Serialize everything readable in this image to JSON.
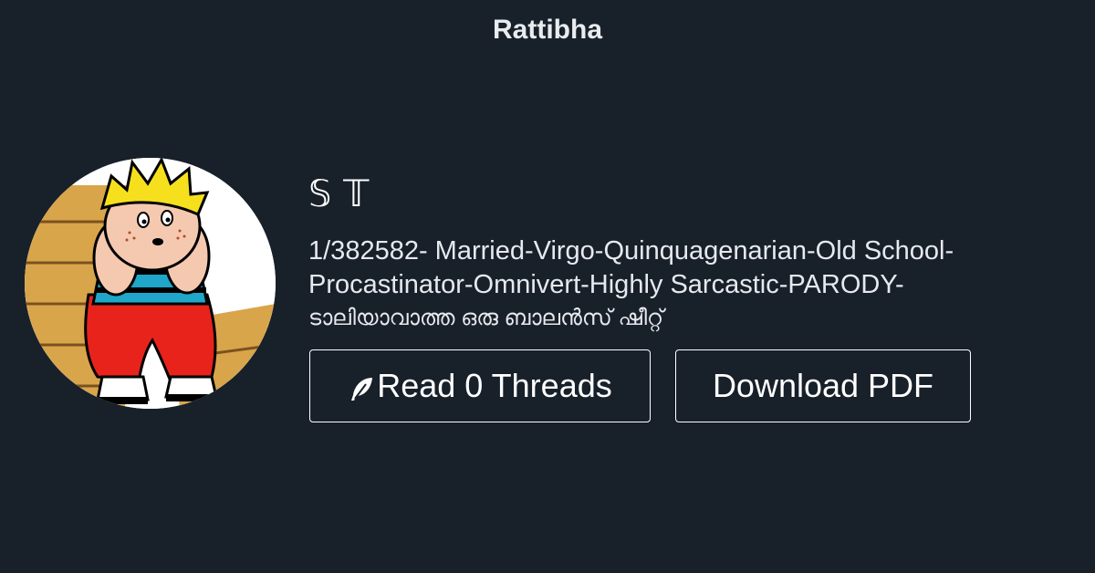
{
  "header": {
    "brand": "Rattibha"
  },
  "profile": {
    "avatar_icon": "cartoon-boy-avatar",
    "display_name": "𝕊 𝕋",
    "bio_line": "1/382582- Married-Virgo-Quinquagenarian-Old School-Procastinator-Omnivert-Highly Sarcastic-PARODY-",
    "bio_malayalam": "ടാലിയാവാത്ത ഒരു ബാലൻസ് ഷീറ്റ്"
  },
  "actions": {
    "read_label": "Read 0 Threads",
    "read_icon": "feather-icon",
    "download_label": "Download PDF"
  },
  "colors": {
    "background": "#18202a",
    "text": "#ffffff",
    "button_border": "#ffffff"
  }
}
